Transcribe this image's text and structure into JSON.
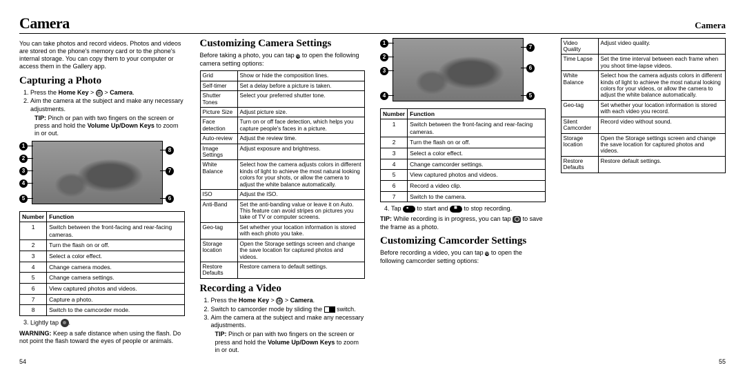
{
  "header": {
    "left": "Camera",
    "right": "Camera"
  },
  "intro": "You can take photos and record videos. Photos and videos are stored on the phone's memory card or to the phone's internal storage. You can copy them to your computer or access them in the Gallery app.",
  "capture": {
    "heading": "Capturing a Photo",
    "step1_a": "Press the ",
    "step1_b": "Home Key",
    "step1_c": " > ",
    "step1_d": " > ",
    "step1_e": "Camera",
    "step1_f": ".",
    "step2": "Aim the camera at the subject and make any necessary adjustments.",
    "tip_label": "TIP:",
    "tip": " Pinch or pan with two fingers on the screen or press and hold the ",
    "tip_b": "Volume Up/Down Keys",
    "tip_c": " to zoom in or out.",
    "table_h1": "Number",
    "table_h2": "Function",
    "rows": [
      {
        "n": "1",
        "f": "Switch between the front-facing and rear-facing cameras."
      },
      {
        "n": "2",
        "f": "Turn the flash on or off."
      },
      {
        "n": "3",
        "f": "Select a color effect."
      },
      {
        "n": "4",
        "f": "Change camera modes."
      },
      {
        "n": "5",
        "f": "Change camera settings."
      },
      {
        "n": "6",
        "f": "View captured photos and videos."
      },
      {
        "n": "7",
        "f": "Capture a photo."
      },
      {
        "n": "8",
        "f": "Switch to the camcorder mode."
      }
    ],
    "step3_a": "Lightly tap ",
    "step3_b": "."
  },
  "warning_label": "WARNING:",
  "warning": " Keep a safe distance when using the flash. Do not point the flash toward the eyes of people or animals.",
  "camset": {
    "heading": "Customizing Camera Settings",
    "intro_a": "Before taking a photo, you can tap ",
    "intro_b": " to open the following camera setting options:",
    "rows": [
      {
        "k": "Grid",
        "v": "Show or hide the composition lines."
      },
      {
        "k": "Self-timer",
        "v": "Set a delay before a picture is taken."
      },
      {
        "k": "Shutter Tones",
        "v": "Select your preferred shutter tone."
      },
      {
        "k": "Picture Size",
        "v": "Adjust picture size."
      },
      {
        "k": "Face detection",
        "v": "Turn on or off face detection, which helps you capture people's faces in a picture."
      },
      {
        "k": "Auto-review",
        "v": "Adjust the review time."
      },
      {
        "k": "Image Settings",
        "v": "Adjust exposure and brightness."
      },
      {
        "k": "White Balance",
        "v": "Select how the camera adjusts colors in different kinds of light to achieve the most natural looking colors for your shots, or allow the camera to adjust the white balance automatically."
      },
      {
        "k": "ISO",
        "v": "Adjust the ISO."
      },
      {
        "k": "Anti-Band",
        "v": "Set the anti-banding value or leave it on Auto. This feature can avoid stripes on pictures you take of TV or computer screens."
      },
      {
        "k": "Geo-tag",
        "v": "Set whether your location information is stored with each photo you take."
      },
      {
        "k": "Storage location",
        "v": "Open the Storage settings screen and change the save location for captured photos and videos."
      },
      {
        "k": "Restore Defaults",
        "v": "Restore camera to default settings."
      }
    ]
  },
  "video": {
    "heading": "Recording a Video",
    "step1_a": "Press the ",
    "step1_b": "Home Key",
    "step1_c": " > ",
    "step1_d": " > ",
    "step1_e": "Camera",
    "step1_f": ".",
    "step2_a": "Switch to camcorder mode by sliding the ",
    "step2_b": " switch.",
    "step3": "Aim the camera at the subject and make any necessary adjustments.",
    "tip_label": "TIP:",
    "tip": " Pinch or pan with two fingers on the screen or press and hold the ",
    "tip_b": "Volume Up/Down Keys",
    "tip_c": " to zoom in or out.",
    "table_h1": "Number",
    "table_h2": "Function",
    "rows": [
      {
        "n": "1",
        "f": "Switch between the front-facing and rear-facing cameras."
      },
      {
        "n": "2",
        "f": "Turn the flash on or off."
      },
      {
        "n": "3",
        "f": "Select a color effect."
      },
      {
        "n": "4",
        "f": "Change camcorder settings."
      },
      {
        "n": "5",
        "f": "View captured photos and videos."
      },
      {
        "n": "6",
        "f": "Record a video clip."
      },
      {
        "n": "7",
        "f": "Switch to the camera."
      }
    ],
    "step4_a": "Tap ",
    "step4_b": " to start and ",
    "step4_c": " to stop recording.",
    "tip2_label": "TIP:",
    "tip2_a": " While recording is in progress, you can tap ",
    "tip2_b": " to save the frame as a photo."
  },
  "corder": {
    "heading": "Customizing Camcorder Settings",
    "intro_a": "Before recording a video, you can tap ",
    "intro_b": " to open the following camcorder setting options:",
    "rows": [
      {
        "k": "Video Quality",
        "v": "Adjust video quality."
      },
      {
        "k": "Time Lapse",
        "v": "Set the time interval between each frame when you shoot time-lapse videos."
      },
      {
        "k": "White Balance",
        "v": "Select how the camera adjusts colors in different kinds of light to achieve the most natural looking colors for your videos, or allow the camera to adjust the white balance automatically."
      },
      {
        "k": "Geo-tag",
        "v": "Set whether your location information is stored with each video you record."
      },
      {
        "k": "Silent Camcorder",
        "v": "Record video without sound."
      },
      {
        "k": "Storage location",
        "v": "Open the Storage settings screen and change the save location for captured photos and videos."
      },
      {
        "k": "Restore Defaults",
        "v": "Restore default settings."
      }
    ]
  },
  "page_left": "54",
  "page_right": "55"
}
